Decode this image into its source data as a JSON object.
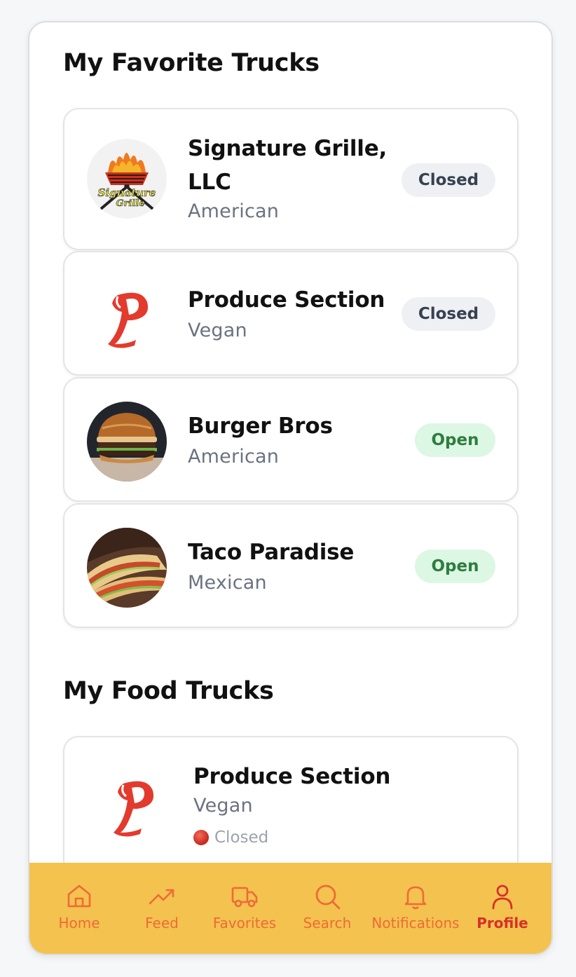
{
  "favorites": {
    "title": "My Favorite Trucks",
    "items": [
      {
        "name": "Signature Grille, LLC",
        "cuisine": "American",
        "status": "Closed"
      },
      {
        "name": "Produce Section",
        "cuisine": "Vegan",
        "status": "Closed"
      },
      {
        "name": "Burger Bros",
        "cuisine": "American",
        "status": "Open"
      },
      {
        "name": "Taco Paradise",
        "cuisine": "Mexican",
        "status": "Open"
      }
    ]
  },
  "my_trucks": {
    "title": "My Food Trucks",
    "items": [
      {
        "name": "Produce Section",
        "cuisine": "Vegan",
        "status": "Closed"
      }
    ]
  },
  "nav": {
    "items": [
      {
        "label": "Home",
        "icon": "home-icon"
      },
      {
        "label": "Feed",
        "icon": "trending-icon"
      },
      {
        "label": "Favorites",
        "icon": "truck-icon"
      },
      {
        "label": "Search",
        "icon": "search-icon"
      },
      {
        "label": "Notifications",
        "icon": "bell-icon"
      },
      {
        "label": "Profile",
        "icon": "user-icon"
      }
    ],
    "active": "Profile"
  },
  "colors": {
    "nav_bg": "#f3c24f",
    "nav_fg": "#ef6a36",
    "nav_active": "#d7302a",
    "open_bg": "#dcf7e3",
    "closed_bg": "#eef0f3"
  }
}
